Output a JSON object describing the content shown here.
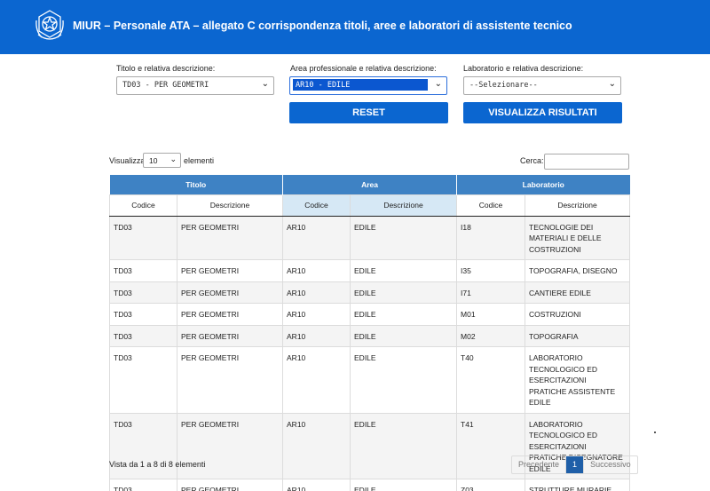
{
  "header": {
    "title": "MIUR – Personale ATA – allegato C corrispondenza titoli, aree e laboratori di assistente tecnico",
    "background_color": "#0b66d0",
    "emblem_icon": "italian-republic-emblem"
  },
  "filters": {
    "titolo_label": "Titolo e relativa descrizione:",
    "titolo_value": "TD03 - PER GEOMETRI",
    "area_label": "Area professionale e relativa descrizione:",
    "area_value": "AR10 - EDILE",
    "laboratorio_label": "Laboratorio e relativa descrizione:",
    "laboratorio_value": "--Selezionare--",
    "reset_label": "RESET",
    "visualizza_label": "VISUALIZZA RISULTATI"
  },
  "table_controls": {
    "show_prefix": "Visualizza",
    "page_length": "10",
    "show_suffix": "elementi",
    "search_label": "Cerca:",
    "search_value": ""
  },
  "table": {
    "groups": [
      "Titolo",
      "Area",
      "Laboratorio"
    ],
    "columns": [
      "Codice",
      "Descrizione",
      "Codice",
      "Descrizione",
      "Codice",
      "Descrizione"
    ],
    "header_color": "#3e82c4",
    "rows": [
      [
        "TD03",
        "PER GEOMETRI",
        "AR10",
        "EDILE",
        "I18",
        "TECNOLOGIE DEI MATERIALI E DELLE COSTRUZIONI"
      ],
      [
        "TD03",
        "PER GEOMETRI",
        "AR10",
        "EDILE",
        "I35",
        "TOPOGRAFIA, DISEGNO"
      ],
      [
        "TD03",
        "PER GEOMETRI",
        "AR10",
        "EDILE",
        "I71",
        "CANTIERE EDILE"
      ],
      [
        "TD03",
        "PER GEOMETRI",
        "AR10",
        "EDILE",
        "M01",
        "COSTRUZIONI"
      ],
      [
        "TD03",
        "PER GEOMETRI",
        "AR10",
        "EDILE",
        "M02",
        "TOPOGRAFIA"
      ],
      [
        "TD03",
        "PER GEOMETRI",
        "AR10",
        "EDILE",
        "T40",
        "LABORATORIO TECNOLOGICO ED ESERCITAZIONI PRATICHE ASSISTENTE EDILE"
      ],
      [
        "TD03",
        "PER GEOMETRI",
        "AR10",
        "EDILE",
        "T41",
        "LABORATORIO TECNOLOGICO ED ESERCITAZIONI PRATICHE DISEGNATORE EDILE"
      ],
      [
        "TD03",
        "PER GEOMETRI",
        "AR10",
        "EDILE",
        "Z03",
        "STRUTTURE MURARIE"
      ]
    ]
  },
  "footer": {
    "info": "Vista da 1 a 8 di 8 elementi",
    "prev_label": "Precedente",
    "current_page": "1",
    "next_label": "Successivo"
  }
}
